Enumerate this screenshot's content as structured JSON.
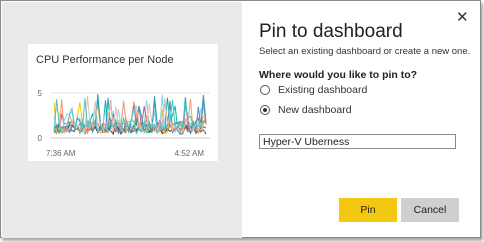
{
  "dialog": {
    "title": "Pin to dashboard",
    "subtitle": "Select an existing dashboard or create a new one.",
    "close_icon": "close-icon",
    "question": "Where would you like to pin to?",
    "options": [
      {
        "label": "Existing dashboard",
        "selected": false
      },
      {
        "label": "New dashboard",
        "selected": true
      }
    ],
    "dashboard_name_value": "Hyper-V Uberness",
    "pin_label": "Pin",
    "cancel_label": "Cancel",
    "colors": {
      "pin": "#f2c811",
      "cancel": "#cfcfcf",
      "preview_bg": "#eaeaea"
    }
  },
  "tile": {
    "title": "CPU Performance per Node",
    "chart_data": {
      "type": "line",
      "y_ticks": [
        "5",
        "0"
      ],
      "x_ticks": [
        "7:36 AM",
        "4:52 AM"
      ],
      "ylim": [
        0,
        5
      ],
      "series_colors": [
        "#fd625e",
        "#01b8aa",
        "#374649",
        "#f2c80f",
        "#8ad4eb",
        "#a66999",
        "#fe9666",
        "#3599b8",
        "#dfbfbf",
        "#4ac5bb"
      ]
    }
  }
}
